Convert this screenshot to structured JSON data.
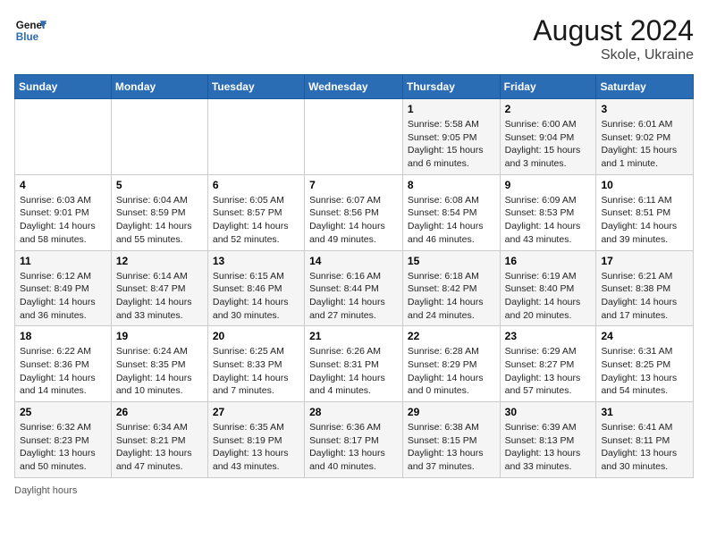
{
  "header": {
    "logo_line1": "General",
    "logo_line2": "Blue",
    "month_year": "August 2024",
    "location": "Skole, Ukraine"
  },
  "days_of_week": [
    "Sunday",
    "Monday",
    "Tuesday",
    "Wednesday",
    "Thursday",
    "Friday",
    "Saturday"
  ],
  "weeks": [
    [
      {
        "day": "",
        "info": ""
      },
      {
        "day": "",
        "info": ""
      },
      {
        "day": "",
        "info": ""
      },
      {
        "day": "",
        "info": ""
      },
      {
        "day": "1",
        "info": "Sunrise: 5:58 AM\nSunset: 9:05 PM\nDaylight: 15 hours and 6 minutes."
      },
      {
        "day": "2",
        "info": "Sunrise: 6:00 AM\nSunset: 9:04 PM\nDaylight: 15 hours and 3 minutes."
      },
      {
        "day": "3",
        "info": "Sunrise: 6:01 AM\nSunset: 9:02 PM\nDaylight: 15 hours and 1 minute."
      }
    ],
    [
      {
        "day": "4",
        "info": "Sunrise: 6:03 AM\nSunset: 9:01 PM\nDaylight: 14 hours and 58 minutes."
      },
      {
        "day": "5",
        "info": "Sunrise: 6:04 AM\nSunset: 8:59 PM\nDaylight: 14 hours and 55 minutes."
      },
      {
        "day": "6",
        "info": "Sunrise: 6:05 AM\nSunset: 8:57 PM\nDaylight: 14 hours and 52 minutes."
      },
      {
        "day": "7",
        "info": "Sunrise: 6:07 AM\nSunset: 8:56 PM\nDaylight: 14 hours and 49 minutes."
      },
      {
        "day": "8",
        "info": "Sunrise: 6:08 AM\nSunset: 8:54 PM\nDaylight: 14 hours and 46 minutes."
      },
      {
        "day": "9",
        "info": "Sunrise: 6:09 AM\nSunset: 8:53 PM\nDaylight: 14 hours and 43 minutes."
      },
      {
        "day": "10",
        "info": "Sunrise: 6:11 AM\nSunset: 8:51 PM\nDaylight: 14 hours and 39 minutes."
      }
    ],
    [
      {
        "day": "11",
        "info": "Sunrise: 6:12 AM\nSunset: 8:49 PM\nDaylight: 14 hours and 36 minutes."
      },
      {
        "day": "12",
        "info": "Sunrise: 6:14 AM\nSunset: 8:47 PM\nDaylight: 14 hours and 33 minutes."
      },
      {
        "day": "13",
        "info": "Sunrise: 6:15 AM\nSunset: 8:46 PM\nDaylight: 14 hours and 30 minutes."
      },
      {
        "day": "14",
        "info": "Sunrise: 6:16 AM\nSunset: 8:44 PM\nDaylight: 14 hours and 27 minutes."
      },
      {
        "day": "15",
        "info": "Sunrise: 6:18 AM\nSunset: 8:42 PM\nDaylight: 14 hours and 24 minutes."
      },
      {
        "day": "16",
        "info": "Sunrise: 6:19 AM\nSunset: 8:40 PM\nDaylight: 14 hours and 20 minutes."
      },
      {
        "day": "17",
        "info": "Sunrise: 6:21 AM\nSunset: 8:38 PM\nDaylight: 14 hours and 17 minutes."
      }
    ],
    [
      {
        "day": "18",
        "info": "Sunrise: 6:22 AM\nSunset: 8:36 PM\nDaylight: 14 hours and 14 minutes."
      },
      {
        "day": "19",
        "info": "Sunrise: 6:24 AM\nSunset: 8:35 PM\nDaylight: 14 hours and 10 minutes."
      },
      {
        "day": "20",
        "info": "Sunrise: 6:25 AM\nSunset: 8:33 PM\nDaylight: 14 hours and 7 minutes."
      },
      {
        "day": "21",
        "info": "Sunrise: 6:26 AM\nSunset: 8:31 PM\nDaylight: 14 hours and 4 minutes."
      },
      {
        "day": "22",
        "info": "Sunrise: 6:28 AM\nSunset: 8:29 PM\nDaylight: 14 hours and 0 minutes."
      },
      {
        "day": "23",
        "info": "Sunrise: 6:29 AM\nSunset: 8:27 PM\nDaylight: 13 hours and 57 minutes."
      },
      {
        "day": "24",
        "info": "Sunrise: 6:31 AM\nSunset: 8:25 PM\nDaylight: 13 hours and 54 minutes."
      }
    ],
    [
      {
        "day": "25",
        "info": "Sunrise: 6:32 AM\nSunset: 8:23 PM\nDaylight: 13 hours and 50 minutes."
      },
      {
        "day": "26",
        "info": "Sunrise: 6:34 AM\nSunset: 8:21 PM\nDaylight: 13 hours and 47 minutes."
      },
      {
        "day": "27",
        "info": "Sunrise: 6:35 AM\nSunset: 8:19 PM\nDaylight: 13 hours and 43 minutes."
      },
      {
        "day": "28",
        "info": "Sunrise: 6:36 AM\nSunset: 8:17 PM\nDaylight: 13 hours and 40 minutes."
      },
      {
        "day": "29",
        "info": "Sunrise: 6:38 AM\nSunset: 8:15 PM\nDaylight: 13 hours and 37 minutes."
      },
      {
        "day": "30",
        "info": "Sunrise: 6:39 AM\nSunset: 8:13 PM\nDaylight: 13 hours and 33 minutes."
      },
      {
        "day": "31",
        "info": "Sunrise: 6:41 AM\nSunset: 8:11 PM\nDaylight: 13 hours and 30 minutes."
      }
    ]
  ],
  "footer": {
    "daylight_label": "Daylight hours"
  }
}
